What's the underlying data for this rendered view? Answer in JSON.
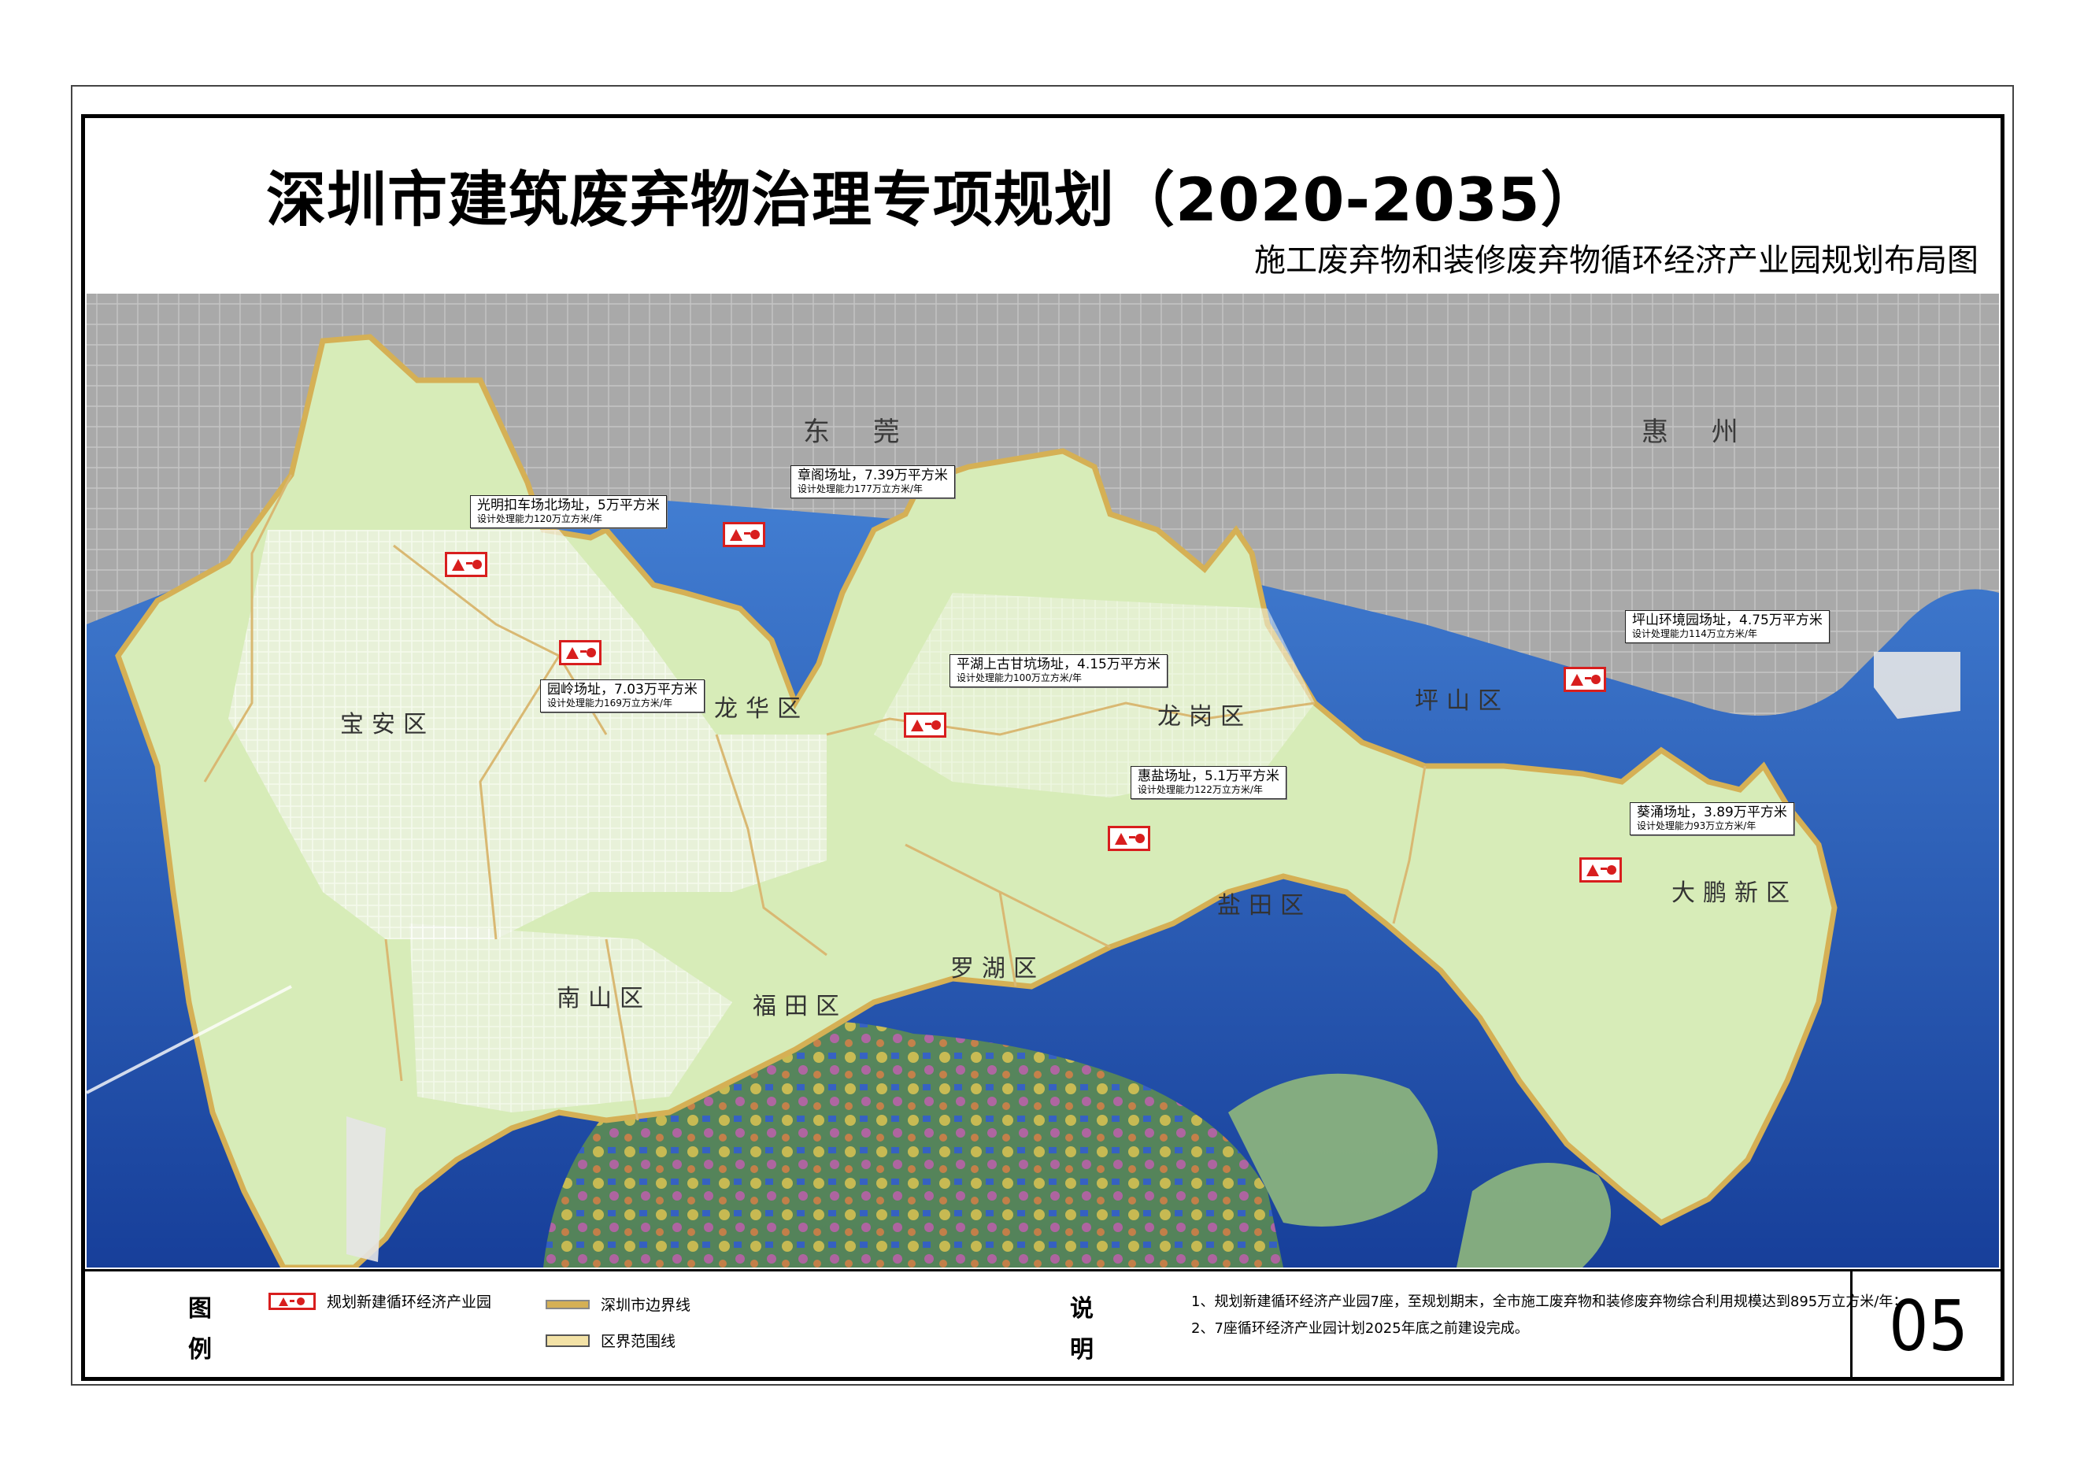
{
  "title": "深圳市建筑废弃物治理专项规划（2020-2035）",
  "subtitle": "施工废弃物和装修废弃物循环经济产业园规划布局图",
  "neighbors": [
    "东 莞",
    "惠 州"
  ],
  "districts": [
    "宝安区",
    "龙华区",
    "龙岗区",
    "坪山区",
    "盐田区",
    "大鹏新区",
    "南山区",
    "福田区",
    "罗湖区"
  ],
  "sites": [
    {
      "name": "光明扣车场北场址，5万平方米",
      "capacity": "设计处理能力120万立方米/年"
    },
    {
      "name": "章阁场址，7.39万平方米",
      "capacity": "设计处理能力177万立方米/年"
    },
    {
      "name": "园岭场址，7.03万平方米",
      "capacity": "设计处理能力169万立方米/年"
    },
    {
      "name": "平湖上古甘坑场址，4.15万平方米",
      "capacity": "设计处理能力100万立方米/年"
    },
    {
      "name": "惠盐场址，5.1万平方米",
      "capacity": "设计处理能力122万立方米/年"
    },
    {
      "name": "坪山环境园场址，4.75万平方米",
      "capacity": "设计处理能力114万立方米/年"
    },
    {
      "name": "葵涌场址，3.89万平方米",
      "capacity": "设计处理能力93万立方米/年"
    }
  ],
  "legend": {
    "heading_1": "图",
    "heading_2": "例",
    "items": [
      "规划新建循环经济产业园",
      "深圳市边界线",
      "区界范围线"
    ]
  },
  "notes": {
    "heading_1": "说",
    "heading_2": "明",
    "lines": [
      "1、规划新建循环经济产业园7座，至规划期末，全市施工废弃物和装修废弃物综合利用规模达到895万立方米/年；",
      "2、7座循环经济产业园计划2025年底之前建设完成。"
    ]
  },
  "page_number": "05",
  "colors": {
    "shenzhen_land": "#d7ecb8",
    "sea": "#2a63c2",
    "terrain": "#a9a9a9",
    "city_boundary": "#d5b055",
    "marker_red": "#d81e1e"
  }
}
